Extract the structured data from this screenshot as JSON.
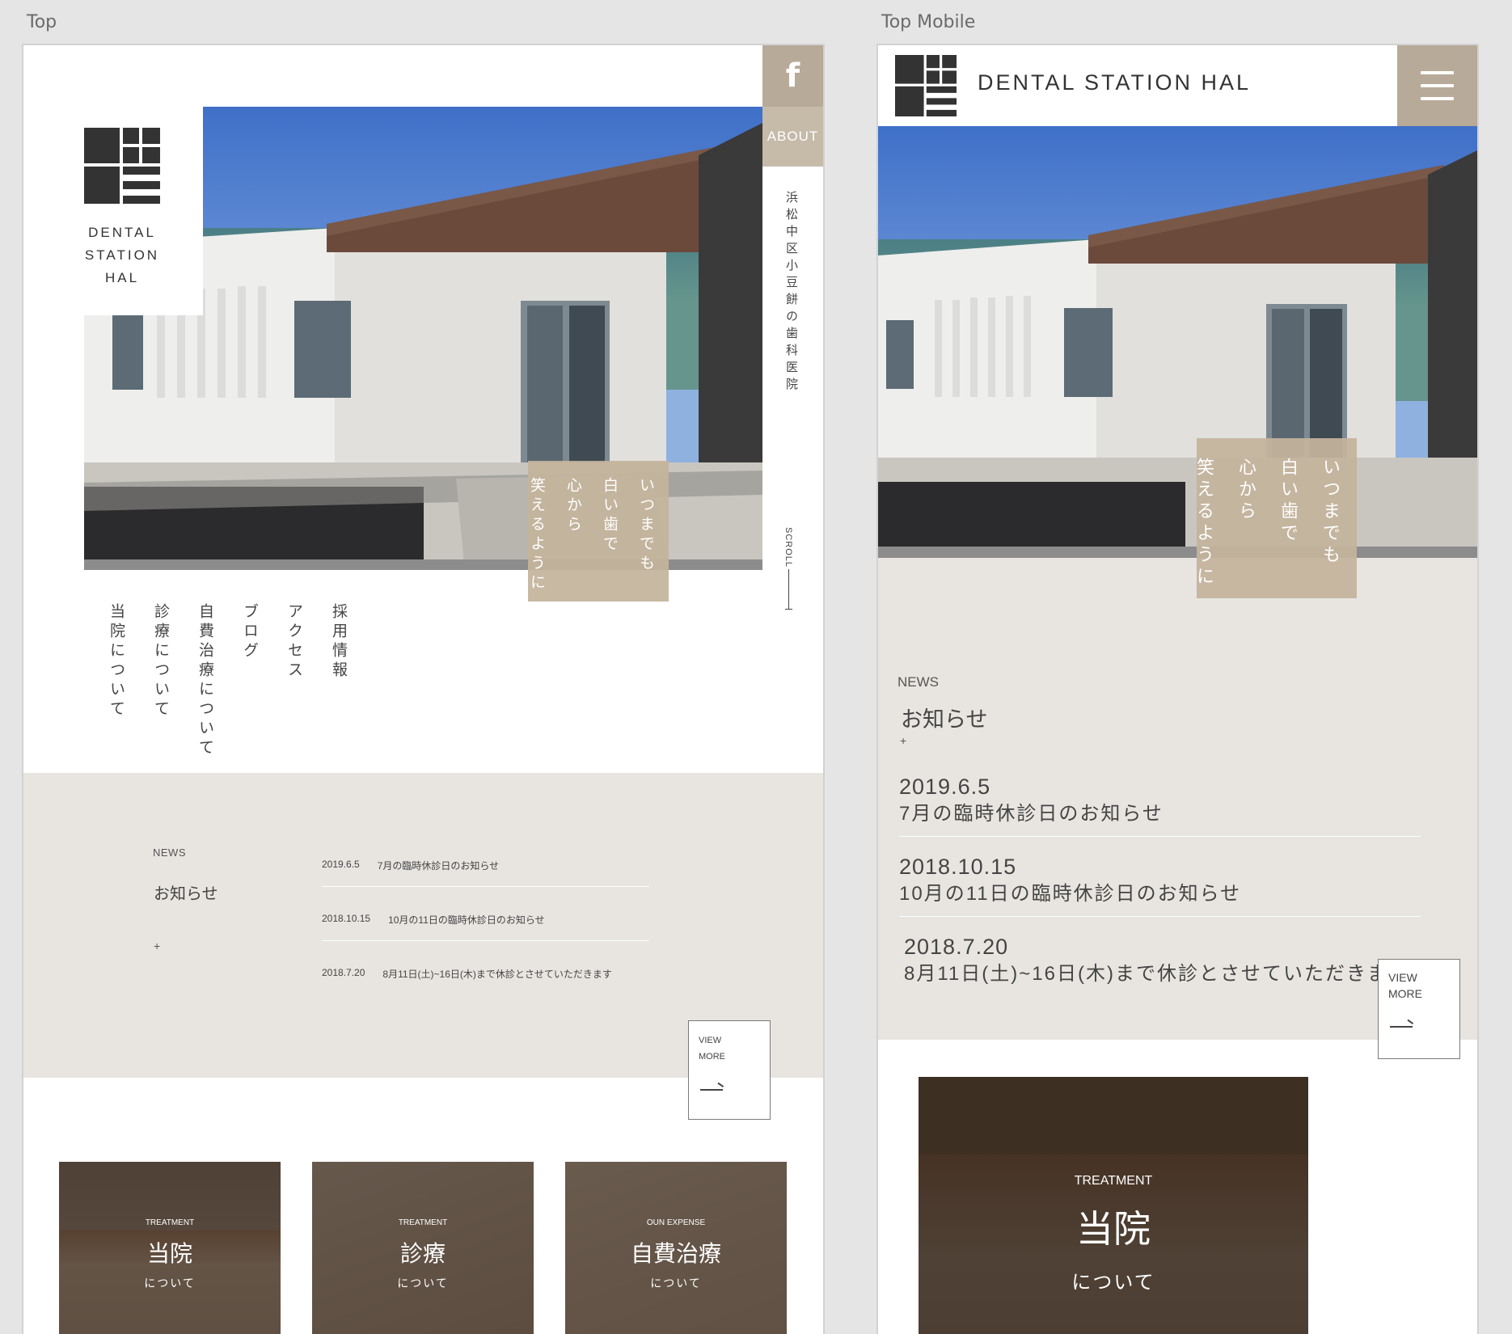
{
  "labels": {
    "desktop": "Top",
    "mobile": "Top Mobile"
  },
  "brand": {
    "line1": "DENTAL",
    "line2": "STATION",
    "line3": "HAL",
    "full": "DENTAL STATION HAL"
  },
  "header": {
    "facebook_icon": "facebook-icon",
    "about_label": "ABOUT",
    "side_catch": "浜松中区小豆餅の歯科医院",
    "scroll_label": "SCROLL"
  },
  "tagline": {
    "line1": "いつまでも",
    "line2": "白い歯で",
    "line3": "心から",
    "line4": "笑えるように"
  },
  "nav": {
    "items": [
      "採用情報",
      "アクセス",
      "ブログ",
      "自費治療について",
      "診療について",
      "当院について"
    ]
  },
  "news": {
    "kicker": "NEWS",
    "title": "お知らせ",
    "plus": "+",
    "items": [
      {
        "date": "2019.6.5",
        "title": "7月の臨時休診日のお知らせ"
      },
      {
        "date": "2018.10.15",
        "title": "10月の11日の臨時休診日のお知らせ"
      },
      {
        "date": "2018.7.20",
        "title": "8月11日(土)~16日(木)まで休診とさせていただきます"
      }
    ],
    "view_more_line1": "VIEW",
    "view_more_line2": "MORE"
  },
  "cards": [
    {
      "kicker": "TREATMENT",
      "title": "当院",
      "sub": "について"
    },
    {
      "kicker": "TREATMENT",
      "title": "診療",
      "sub": "について"
    },
    {
      "kicker": "OUN EXPENSE",
      "title": "自費治療",
      "sub": "について"
    }
  ],
  "colors": {
    "accent": "#b8aa98",
    "band": "#e8e5e1",
    "card_shade": "#463426"
  }
}
